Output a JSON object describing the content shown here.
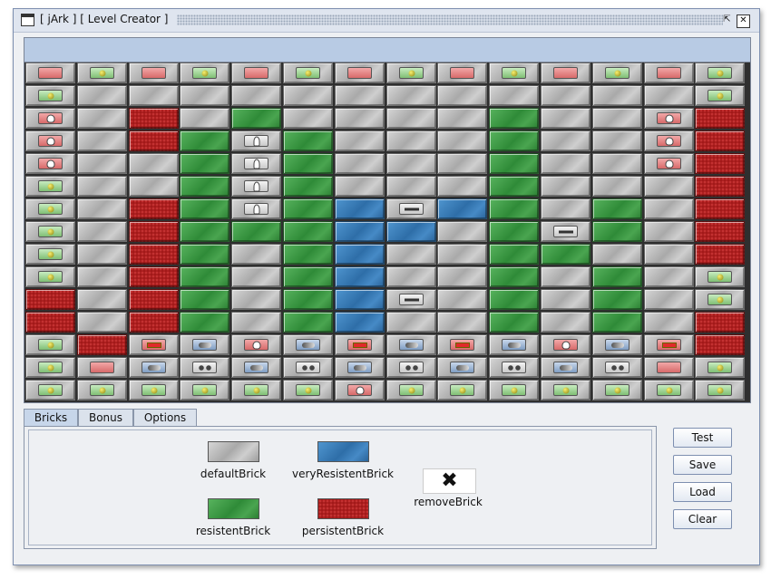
{
  "window": {
    "title": "[ jArk ] [ Level Creator ]",
    "min_glyph": "⇱",
    "close_glyph": "✕"
  },
  "grid": {
    "columns": 14,
    "rows": [
      "R.r G.b R.r G.b R.r G.b R.r G.b R.r G.b R.r G.b R.r G.b",
      "G.b d d d d d d d d d d d d G.b",
      "R.s d p d g d d d d g d d R.s p",
      "R.s d p g W.l g d d d g d d R.s p",
      "R.s d d g W.l g d d d g d d R.s p",
      "G.b d d g W.l g d d d g d d d p",
      "G.b d p g W.l g b W.h b g d g d p",
      "G.b d p g g g b b d g W.h g d p",
      "G.b d p g d g b d d g g d d p",
      "G.b d p g d g b d d g d g d G.b",
      "p d p g d g b W.h d g d g d G.b",
      "p d p g d g b d d g d g d p",
      "G.b p R.x B.c R.s B.c R.x B.c R.x B.c R.s B.c R.x p",
      "G.b R.r B.c W.o B.c W.o B.c W.o B.c W.o B.c W.o R.r G.b",
      "G.b G.b G.b G.b G.b G.b R.s G.b G.b G.b G.b G.b G.b G.b"
    ],
    "legend": {
      "d": "default",
      "g": "resistent",
      "b": "veryResistent",
      "p": "persistent",
      "R": "red-bonus",
      "G": "green-bonus",
      "B": "blue-bonus",
      "W": "white-bonus",
      "marks": {
        "r": "blank",
        "b": "ball",
        "s": "skull",
        "l": "bulb",
        "h": "paddle",
        "x": "bar",
        "c": "capsule",
        "o": "double-ball"
      }
    }
  },
  "tabs": [
    {
      "label": "Bricks",
      "active": true
    },
    {
      "label": "Bonus",
      "active": false
    },
    {
      "label": "Options",
      "active": false
    }
  ],
  "bricks": {
    "default": "defaultBrick",
    "veryResistent": "veryResistentBrick",
    "remove": "removeBrick",
    "resistent": "resistentBrick",
    "persistent": "persistentBrick",
    "remove_glyph": "✖"
  },
  "buttons": {
    "test": "Test",
    "save": "Save",
    "load": "Load",
    "clear": "Clear"
  },
  "colors": {
    "default": "#b4b4b4",
    "resistent": "#3a9a42",
    "veryResistent": "#3a7fbf",
    "persistent": "#b52020"
  }
}
